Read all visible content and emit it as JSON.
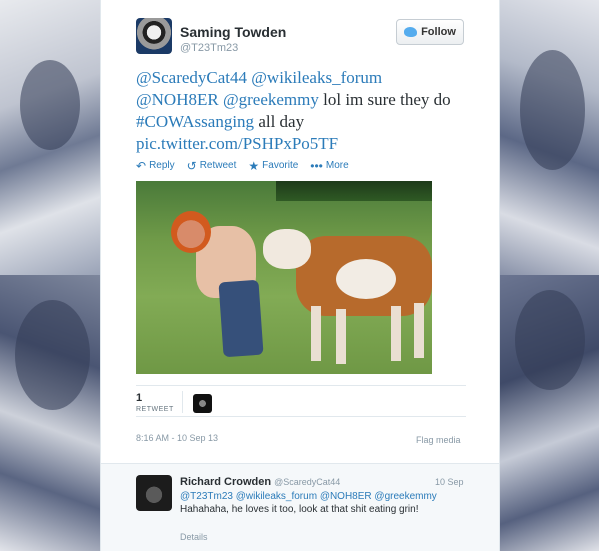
{
  "tweet": {
    "author_name": "Saming Towden",
    "author_handle": "@T23Tm23",
    "follow_label": "Follow",
    "text_parts": {
      "m1": "@ScaredyCat44",
      "m2": "@wikileaks_forum",
      "m3": "@NOH8ER",
      "m4": "@greekemmy",
      "t1": " lol im sure they do ",
      "hashtag": "#COWAssanging",
      "t2": " all day",
      "pic": "pic.twitter.com/PSHPxPo5TF"
    },
    "actions": {
      "reply": "Reply",
      "retweet": "Retweet",
      "favorite": "Favorite",
      "more": "More"
    },
    "retweet_count": "1",
    "retweet_label": "RETWEET",
    "timestamp": "8:16 AM - 10 Sep 13",
    "flag_label": "Flag media"
  },
  "reply": {
    "author_name": "Richard Crowden",
    "author_handle": "@ScaredyCat44",
    "date": "10 Sep",
    "m1": "@T23Tm23",
    "m2": "@wikileaks_forum",
    "m3": "@NOH8ER",
    "m4": "@greekemmy",
    "text": " Hahahaha, he loves it too, look at that shit eating grin!",
    "details_label": "Details"
  },
  "colors": {
    "link": "#2b7bb9",
    "text": "#292f33",
    "muted": "#8899a6"
  }
}
